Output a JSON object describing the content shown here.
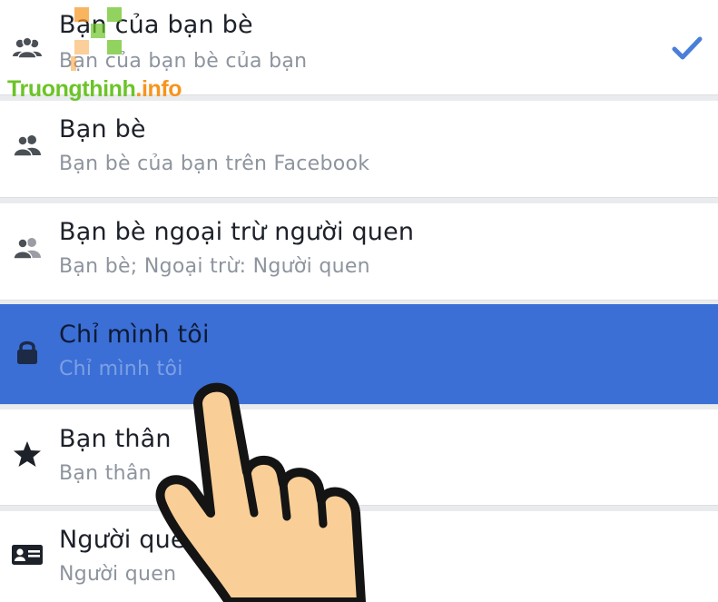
{
  "audience_options": [
    {
      "title": "Bạn của bạn bè",
      "subtitle": "Bạn của bạn bè của bạn",
      "icon": "friends-of-friends-icon",
      "checked": true
    },
    {
      "title": "Bạn bè",
      "subtitle": "Bạn bè của bạn trên Facebook",
      "icon": "friends-icon",
      "checked": false
    },
    {
      "title": "Bạn bè ngoại trừ người quen",
      "subtitle": "Bạn bè; Ngoại trừ: Người quen",
      "icon": "friends-except-icon",
      "checked": false
    },
    {
      "title": "Chỉ mình tôi",
      "subtitle": "Chỉ mình tôi",
      "icon": "lock-icon",
      "checked": false,
      "highlighted": true
    },
    {
      "title": "Bạn thân",
      "subtitle": "Bạn thân",
      "icon": "star-icon",
      "checked": false
    },
    {
      "title": "Người quen",
      "subtitle": "Người quen",
      "icon": "contact-card-icon",
      "checked": false
    }
  ],
  "watermark": {
    "brand": "Truongthinh",
    "dot": ".",
    "tld": "info"
  },
  "colors": {
    "accent": "#4a7fd9",
    "highlight": "#3b6fd6",
    "hand_fill": "#f9cf97"
  }
}
